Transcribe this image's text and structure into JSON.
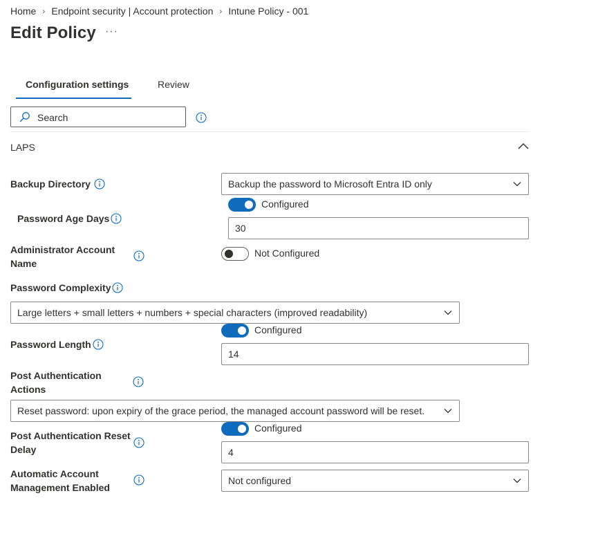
{
  "breadcrumb": {
    "items": [
      "Home",
      "Endpoint security | Account protection",
      "Intune Policy - 001"
    ],
    "separator": "›"
  },
  "page": {
    "title": "Edit Policy",
    "more": "···"
  },
  "tabs": [
    {
      "label": "Configuration settings",
      "active": true
    },
    {
      "label": "Review",
      "active": false
    }
  ],
  "search": {
    "placeholder": "Search",
    "value": ""
  },
  "section": {
    "title": "LAPS",
    "expanded": true
  },
  "settings": {
    "backup_directory": {
      "label": "Backup Directory",
      "value": "Backup the password to Microsoft Entra ID only"
    },
    "password_age_days": {
      "label": "Password Age Days",
      "toggle": "Configured",
      "toggle_on": true,
      "value": "30"
    },
    "admin_account_name": {
      "label_line1": "Administrator Account",
      "label_line2": "Name",
      "toggle": "Not Configured",
      "toggle_on": false
    },
    "password_complexity": {
      "label": "Password Complexity",
      "value": "Large letters + small letters + numbers + special characters (improved readability)"
    },
    "password_length": {
      "label": "Password Length",
      "toggle": "Configured",
      "toggle_on": true,
      "value": "14"
    },
    "post_auth_actions": {
      "label_line1": "Post Authentication",
      "label_line2": "Actions",
      "value": "Reset password: upon expiry of the grace period, the managed account password will be reset."
    },
    "post_auth_reset_delay": {
      "label_line1": "Post Authentication Reset",
      "label_line2": "Delay",
      "toggle": "Configured",
      "toggle_on": true,
      "value": "4"
    },
    "auto_account_mgmt": {
      "label_line1": "Automatic Account",
      "label_line2": "Management Enabled",
      "value": "Not configured"
    }
  },
  "colors": {
    "accent": "#0f6cbd",
    "text": "#323130",
    "border": "#8a8886"
  },
  "icons": {
    "info": "info-icon",
    "search": "search-icon",
    "chevron_down": "chevron-down-icon",
    "chevron_up": "chevron-up-icon"
  }
}
